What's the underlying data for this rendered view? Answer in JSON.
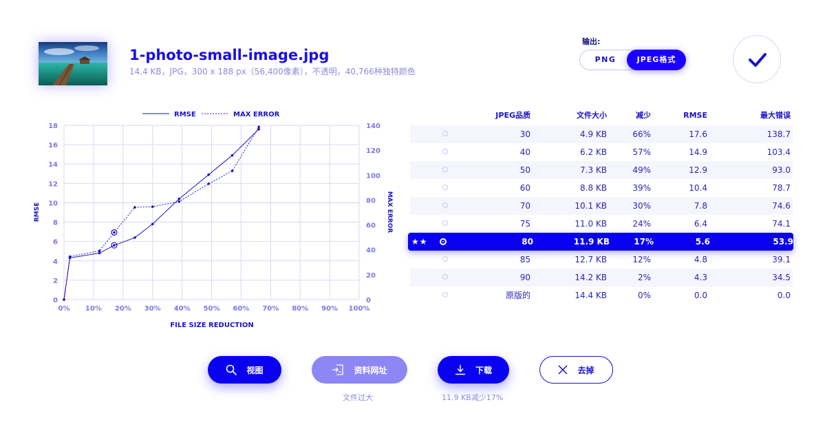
{
  "file": {
    "name": "1-photo-small-image.jpg",
    "meta": "14.4 KB，JPG，300 x 188 px（56,400像素），不透明，40,766种独特颜色"
  },
  "output": {
    "label": "输出:",
    "options": [
      "PNG",
      "JPEG格式"
    ],
    "selected": "JPEG格式"
  },
  "chart_data": {
    "type": "line",
    "xlabel": "FILE SIZE REDUCTION",
    "ylabel": "RMSE",
    "y2label": "MAX ERROR",
    "xlim": [
      0,
      100
    ],
    "ylim": [
      0,
      18
    ],
    "y2lim": [
      0,
      140
    ],
    "x_ticks": [
      "0%",
      "10%",
      "20%",
      "30%",
      "40%",
      "50%",
      "60%",
      "70%",
      "80%",
      "90%",
      "100%"
    ],
    "y_ticks": [
      "0",
      "2",
      "4",
      "6",
      "8",
      "10",
      "12",
      "14",
      "16",
      "18"
    ],
    "y2_ticks": [
      "0",
      "20",
      "40",
      "60",
      "80",
      "100",
      "120",
      "140"
    ],
    "legend": [
      "RMSE",
      "MAX ERROR"
    ],
    "legend_position": "top-center",
    "grid": true,
    "series": [
      {
        "name": "RMSE",
        "axis": "left",
        "style": "solid",
        "x": [
          0,
          2,
          12,
          17,
          24,
          30,
          39,
          49,
          57,
          66
        ],
        "y": [
          0,
          4.3,
          4.8,
          5.6,
          6.4,
          7.8,
          10.4,
          12.9,
          14.9,
          17.6
        ]
      },
      {
        "name": "MAX ERROR",
        "axis": "right",
        "style": "dotted",
        "x": [
          0,
          2,
          12,
          17,
          24,
          30,
          39,
          49,
          57,
          66
        ],
        "y": [
          0,
          34.5,
          39.1,
          53.9,
          74.1,
          74.6,
          78.7,
          93.0,
          103.4,
          138.7
        ]
      }
    ],
    "highlight_x": 17
  },
  "table": {
    "headers": [
      "JPEG品质",
      "文件大小",
      "减少",
      "RMSE",
      "最大错误"
    ],
    "rows": [
      {
        "q": "30",
        "size": "4.9 KB",
        "red": "66%",
        "rmse": "17.6",
        "max": "138.7"
      },
      {
        "q": "40",
        "size": "6.2 KB",
        "red": "57%",
        "rmse": "14.9",
        "max": "103.4"
      },
      {
        "q": "50",
        "size": "7.3 KB",
        "red": "49%",
        "rmse": "12.9",
        "max": "93.0"
      },
      {
        "q": "60",
        "size": "8.8 KB",
        "red": "39%",
        "rmse": "10.4",
        "max": "78.7"
      },
      {
        "q": "70",
        "size": "10.1 KB",
        "red": "30%",
        "rmse": "7.8",
        "max": "74.6"
      },
      {
        "q": "75",
        "size": "11.0 KB",
        "red": "24%",
        "rmse": "6.4",
        "max": "74.1"
      },
      {
        "q": "80",
        "size": "11.9 KB",
        "red": "17%",
        "rmse": "5.6",
        "max": "53.9",
        "selected": true,
        "stars": "★★"
      },
      {
        "q": "85",
        "size": "12.7 KB",
        "red": "12%",
        "rmse": "4.8",
        "max": "39.1"
      },
      {
        "q": "90",
        "size": "14.2 KB",
        "red": "2%",
        "rmse": "4.3",
        "max": "34.5"
      },
      {
        "q": "原版的",
        "size": "14.4 KB",
        "red": "0%",
        "rmse": "0.0",
        "max": "0.0"
      }
    ]
  },
  "actions": {
    "view": "视图",
    "link": "资料网址",
    "download": "下载",
    "remove": "去掉",
    "link_note": "文件过大",
    "download_note": "11.9 KB减少17%"
  },
  "icons": {
    "confirm": "check-icon",
    "view": "search-icon",
    "link": "link-icon",
    "download": "download-icon",
    "remove": "close-icon"
  },
  "colors": {
    "primary": "#0a00f0",
    "muted": "#8d8ad8",
    "grid": "#d9d7f7",
    "disabled_button": "#8d86f5"
  }
}
